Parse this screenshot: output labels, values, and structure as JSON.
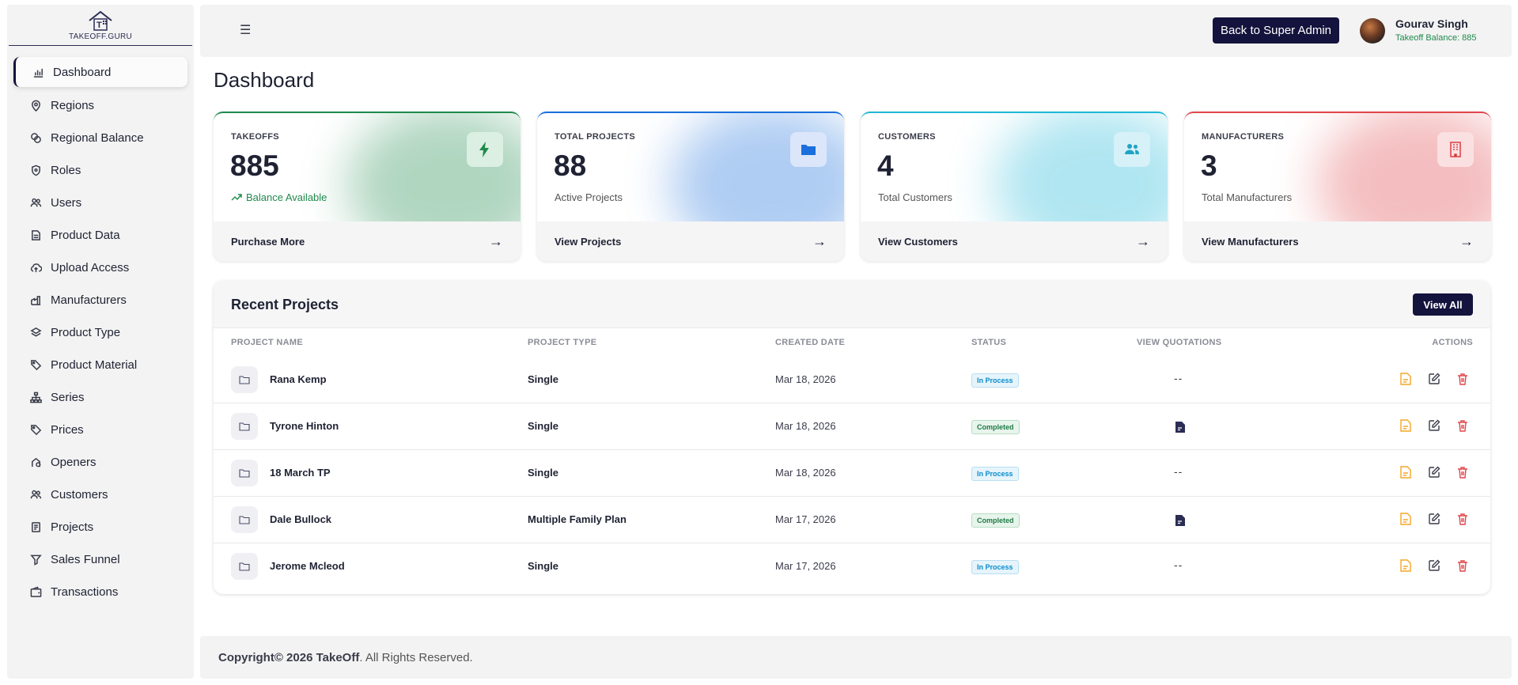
{
  "brand": {
    "logo_text": "TAKEOFF.GURU"
  },
  "sidebar": {
    "items": [
      {
        "label": "Dashboard",
        "icon": "bar-chart-icon",
        "active": true
      },
      {
        "label": "Regions",
        "icon": "map-pin-icon"
      },
      {
        "label": "Regional Balance",
        "icon": "coins-icon"
      },
      {
        "label": "Roles",
        "icon": "shield-icon"
      },
      {
        "label": "Users",
        "icon": "users-icon"
      },
      {
        "label": "Product Data",
        "icon": "database-icon"
      },
      {
        "label": "Upload Access",
        "icon": "cloud-upload-icon"
      },
      {
        "label": "Manufacturers",
        "icon": "factory-icon"
      },
      {
        "label": "Product Type",
        "icon": "layers-icon"
      },
      {
        "label": "Product Material",
        "icon": "tags-icon"
      },
      {
        "label": "Series",
        "icon": "sitemap-icon"
      },
      {
        "label": "Prices",
        "icon": "tag-icon"
      },
      {
        "label": "Openers",
        "icon": "opener-icon"
      },
      {
        "label": "Customers",
        "icon": "users-icon"
      },
      {
        "label": "Projects",
        "icon": "clipboard-icon"
      },
      {
        "label": "Sales Funnel",
        "icon": "funnel-icon"
      },
      {
        "label": "Transactions",
        "icon": "wallet-icon"
      }
    ]
  },
  "topbar": {
    "menu_icon": "☰",
    "back_button": "Back to Super Admin",
    "user_name": "Gourav Singh",
    "user_balance": "Takeoff Balance: 885"
  },
  "page": {
    "title": "Dashboard"
  },
  "cards": [
    {
      "label": "TAKEOFFS",
      "value": "885",
      "sub": "Balance Available",
      "link": "Purchase More",
      "accent": "#1f8a4c",
      "icon": "bolt-icon"
    },
    {
      "label": "TOTAL PROJECTS",
      "value": "88",
      "sub": "Active Projects",
      "link": "View Projects",
      "accent": "#1a6fdc",
      "icon": "folder-icon"
    },
    {
      "label": "CUSTOMERS",
      "value": "4",
      "sub": "Total Customers",
      "link": "View Customers",
      "accent": "#1fb8d8",
      "icon": "users-icon"
    },
    {
      "label": "MANUFACTURERS",
      "value": "3",
      "sub": "Total Manufacturers",
      "link": "View Manufacturers",
      "accent": "#e0474c",
      "icon": "building-icon"
    }
  ],
  "recent": {
    "title": "Recent Projects",
    "view_all": "View All",
    "headers": [
      "PROJECT NAME",
      "PROJECT TYPE",
      "CREATED DATE",
      "STATUS",
      "VIEW QUOTATIONS",
      "ACTIONS"
    ],
    "rows": [
      {
        "name": "Rana Kemp",
        "type": "Single",
        "date": "Mar 18, 2026",
        "status": "In Process",
        "quotation": "--"
      },
      {
        "name": "Tyrone Hinton",
        "type": "Single",
        "date": "Mar 18, 2026",
        "status": "Completed",
        "quotation": "document-icon"
      },
      {
        "name": "18 March TP",
        "type": "Single",
        "date": "Mar 18, 2026",
        "status": "In Process",
        "quotation": "--"
      },
      {
        "name": "Dale Bullock",
        "type": "Multiple Family Plan",
        "date": "Mar 17, 2026",
        "status": "Completed",
        "quotation": "document-icon"
      },
      {
        "name": "Jerome Mcleod",
        "type": "Single",
        "date": "Mar 17, 2026",
        "status": "In Process",
        "quotation": "--"
      }
    ]
  },
  "footer": {
    "copyright": "Copyright© 2026 TakeOff",
    "rights": ". All Rights Reserved."
  }
}
